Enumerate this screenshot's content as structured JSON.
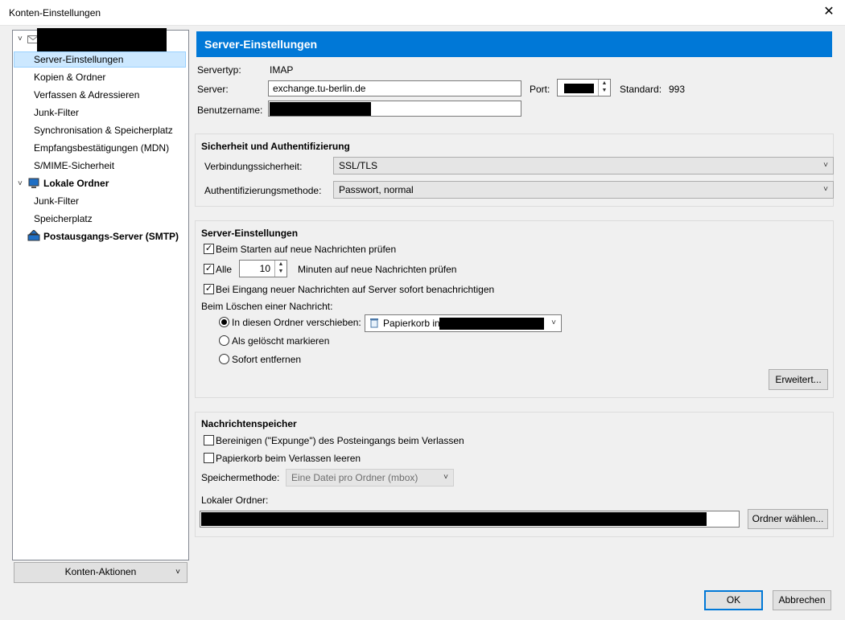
{
  "window": {
    "title": "Konten-Einstellungen",
    "close_glyph": "✕"
  },
  "sidebar": {
    "items": [
      {
        "label": "Server-Einstellungen"
      },
      {
        "label": "Kopien & Ordner"
      },
      {
        "label": "Verfassen & Adressieren"
      },
      {
        "label": "Junk-Filter"
      },
      {
        "label": "Synchronisation & Speicherplatz"
      },
      {
        "label": "Empfangsbestätigungen (MDN)"
      },
      {
        "label": "S/MIME-Sicherheit"
      }
    ],
    "local_folders": {
      "label": "Lokale Ordner",
      "children": [
        "Junk-Filter",
        "Speicherplatz"
      ]
    },
    "smtp": {
      "label": "Postausgangs-Server (SMTP)"
    },
    "account_actions": "Konten-Aktionen"
  },
  "main": {
    "header": "Server-Einstellungen",
    "server_type_label": "Servertyp:",
    "server_type_value": "IMAP",
    "server_label": "Server:",
    "server_value": "exchange.tu-berlin.de",
    "port_label": "Port:",
    "standard_label": "Standard:",
    "standard_value": "993",
    "username_label": "Benutzername:",
    "security": {
      "title": "Sicherheit und Authentifizierung",
      "conn_label": "Verbindungssicherheit:",
      "conn_value": "SSL/TLS",
      "auth_label": "Authentifizierungsmethode:",
      "auth_value": "Passwort, normal"
    },
    "server_settings": {
      "title": "Server-Einstellungen",
      "check_startup": "Beim Starten auf neue Nachrichten prüfen",
      "check_every_label": "Alle",
      "check_every_value": "10",
      "check_every_suffix": "Minuten auf neue Nachrichten prüfen",
      "notify_label": "Bei Eingang neuer Nachrichten auf Server sofort benachrichtigen",
      "delete_label": "Beim Löschen einer Nachricht:",
      "move_to_label": "In diesen Ordner verschieben:",
      "move_to_value": "Papierkorb in",
      "mark_deleted": "Als gelöscht markieren",
      "remove_now": "Sofort entfernen",
      "advanced_button": "Erweitert..."
    },
    "storage": {
      "title": "Nachrichtenspeicher",
      "expunge_label": "Bereinigen (\"Expunge\") des Posteingangs beim Verlassen",
      "empty_trash_label": "Papierkorb beim Verlassen leeren",
      "method_label": "Speichermethode:",
      "method_value": "Eine Datei pro Ordner (mbox)",
      "local_dir_label": "Lokaler Ordner:",
      "choose_button": "Ordner wählen..."
    }
  },
  "footer": {
    "ok": "OK",
    "cancel": "Abbrechen"
  }
}
